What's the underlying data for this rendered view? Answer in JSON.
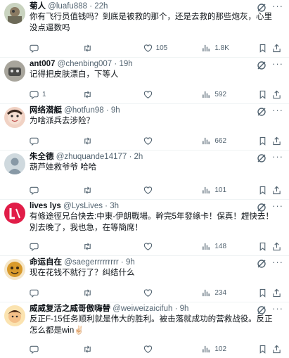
{
  "colors": {
    "text": "#0f1419",
    "secondary": "#536471",
    "divider": "#eff3f4"
  },
  "icons": {
    "reply": "reply-icon",
    "retweet": "retweet-icon",
    "like": "heart-icon",
    "views": "views-icon",
    "bookmark": "bookmark-icon",
    "share": "share-icon",
    "grok": "grok-icon",
    "more": "more-icon"
  },
  "tweets": [
    {
      "name": "菊人",
      "handle": "@luafu888",
      "dot": "·",
      "time": "22h",
      "text": "你有飞行员值钱吗？到底是被救的那个，还是去救的那些炮灰，心里没点逼数吗",
      "replies": "",
      "retweets": "",
      "likes": "105",
      "views": "1.8K"
    },
    {
      "name": "ant007",
      "handle": "@chenbing007",
      "dot": "·",
      "time": "19h",
      "text": "记得把皮肤漂白，下等人",
      "replies": "1",
      "retweets": "",
      "likes": "",
      "views": "592"
    },
    {
      "name": "网络潜艇",
      "handle": "@hotfun98",
      "dot": "·",
      "time": "9h",
      "text": "为啥派兵去涉险？",
      "replies": "",
      "retweets": "",
      "likes": "",
      "views": "662"
    },
    {
      "name": "朱全德",
      "handle": "@zhuquande14177",
      "dot": "·",
      "time": "2h",
      "text": "葫芦娃救爷爷 哈哈",
      "replies": "",
      "retweets": "",
      "likes": "",
      "views": "101"
    },
    {
      "name": "lives lys",
      "handle": "@LysLives",
      "dot": "·",
      "time": "3h",
      "text": "有條途徑兄台快去:中東-伊朗戰場。幹完5年發綠卡！保真！趕快去！別去晚了，我也急，在等簡席！",
      "replies": "",
      "retweets": "",
      "likes": "",
      "views": "148"
    },
    {
      "name": "命运自在",
      "handle": "@saegerrrrrrrrr",
      "dot": "·",
      "time": "9h",
      "text": "现在花钱不就行了？纠结什么",
      "replies": "",
      "retweets": "",
      "likes": "",
      "views": "234"
    },
    {
      "name": "威威复活之威哥傲嗨替",
      "handle": "@weiweizaicifuh",
      "dot": "·",
      "time": "9h",
      "text": "反正F-15任务顺利就是伟大的胜利。被击落就成功的营救战役。反正怎么都是win✌🏻",
      "replies": "",
      "retweets": "",
      "likes": "",
      "views": "102"
    }
  ]
}
